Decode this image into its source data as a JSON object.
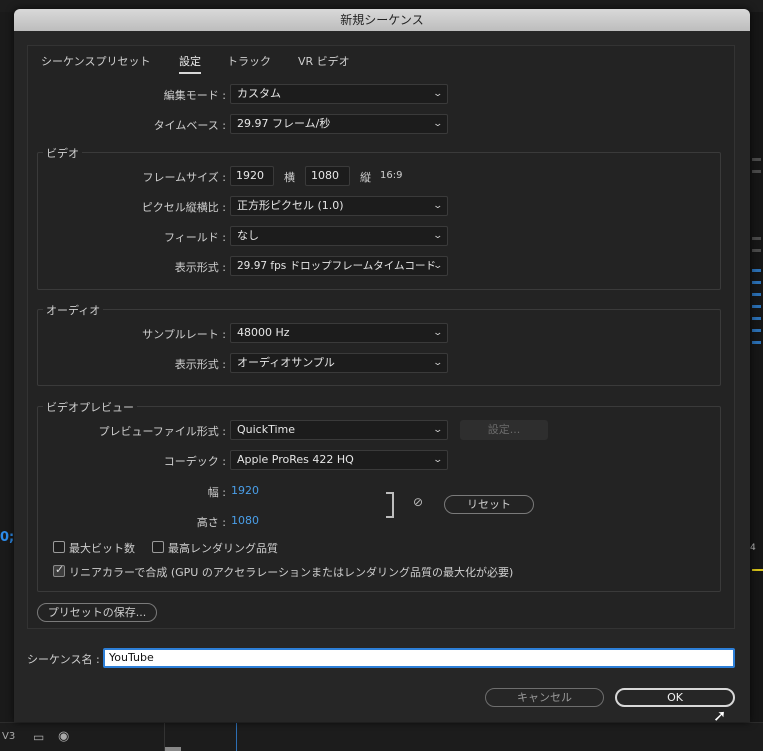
{
  "dialog": {
    "title": "新規シーケンス"
  },
  "tabs": [
    {
      "label": "シーケンスプリセット",
      "active": false
    },
    {
      "label": "設定",
      "active": true
    },
    {
      "label": "トラック",
      "active": false
    },
    {
      "label": "VR ビデオ",
      "active": false
    }
  ],
  "general": {
    "edit_mode_label": "編集モード :",
    "edit_mode_value": "カスタム",
    "timebase_label": "タイムベース :",
    "timebase_value": "29.97  フレーム/秒"
  },
  "video": {
    "group_title": "ビデオ",
    "frame_size_label": "フレームサイズ :",
    "frame_width": "1920",
    "horizontal_label": "横",
    "frame_height": "1080",
    "vertical_label": "縦",
    "aspect_ratio": "16:9",
    "pixel_aspect_label": "ピクセル縦横比 :",
    "pixel_aspect_value": "正方形ピクセル (1.0)",
    "fields_label": "フィールド :",
    "fields_value": "なし",
    "display_format_label": "表示形式 :",
    "display_format_value": "29.97 fps ドロップフレームタイムコード"
  },
  "audio": {
    "group_title": "オーディオ",
    "sample_rate_label": "サンプルレート :",
    "sample_rate_value": "48000 Hz",
    "display_format_label": "表示形式 :",
    "display_format_value": "オーディオサンプル"
  },
  "video_preview": {
    "group_title": "ビデオプレビュー",
    "file_format_label": "プレビューファイル形式 :",
    "file_format_value": "QuickTime",
    "settings_button": "設定...",
    "codec_label": "コーデック :",
    "codec_value": "Apple ProRes 422 HQ",
    "width_label": "幅 :",
    "width_value": "1920",
    "height_label": "高さ :",
    "height_value": "1080",
    "reset_button": "リセット",
    "max_bit_depth_label": "最大ビット数",
    "max_bit_depth_checked": false,
    "max_render_quality_label": "最高レンダリング品質",
    "max_render_quality_checked": false,
    "linear_color_label": "リニアカラーで合成 (GPU のアクセラレーションまたはレンダリング品質の最大化が必要)",
    "linear_color_checked": true
  },
  "save_preset_button": "プリセットの保存...",
  "sequence_name": {
    "label": "シーケンス名 :",
    "value": "YouTube"
  },
  "buttons": {
    "cancel": "キャンセル",
    "ok": "OK"
  },
  "background": {
    "track_label": "V3",
    "left_number": "0;",
    "right_number": "4"
  },
  "colors": {
    "accent_blue": "#2d7fd8",
    "value_blue": "#4a9fe9",
    "dialog_bg": "#262626",
    "titlebar": "#c9c9c9"
  }
}
